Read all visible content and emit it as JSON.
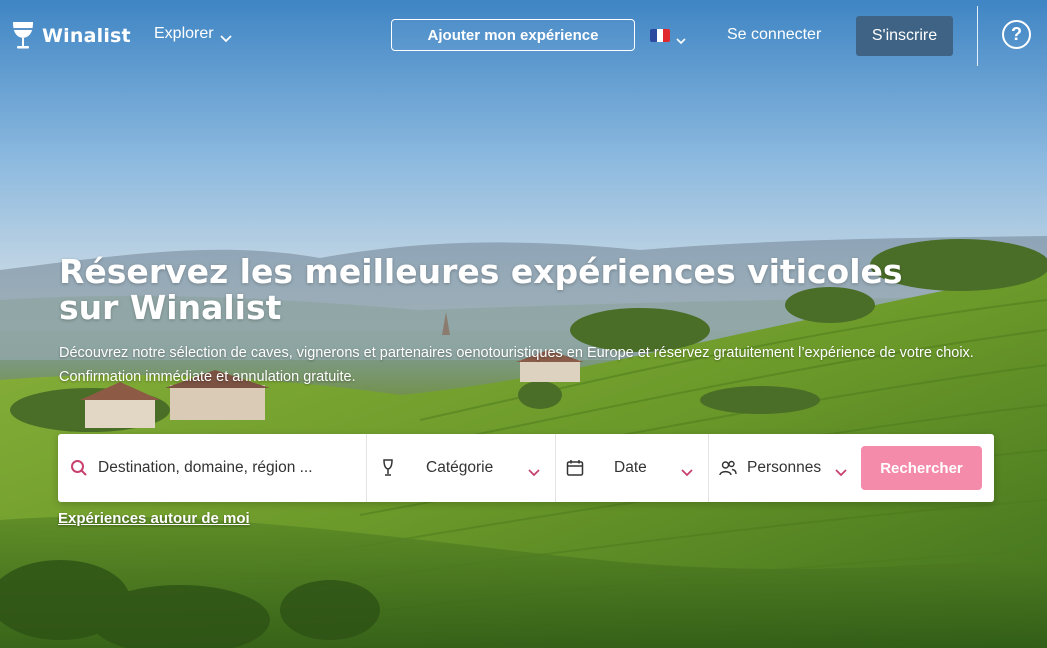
{
  "header": {
    "logo_text": "Winalist",
    "explorer_label": "Explorer",
    "add_experience_label": "Ajouter mon expérience",
    "language": "fr",
    "signin_label": "Se connecter",
    "signup_label": "S'inscrire",
    "help_label": "?"
  },
  "hero": {
    "title": "Réservez les meilleures expériences viticoles sur Winalist",
    "subtitle": "Découvrez notre sélection de caves, vignerons et partenaires oenotouristiques en Europe et réservez gratuitement l’expérience de votre choix. Confirmation immédiate et annulation gratuite."
  },
  "search": {
    "destination_placeholder": "Destination, domaine, région ...",
    "category_label": "Catégorie",
    "date_label": "Date",
    "persons_label": "Personnes",
    "submit_label": "Rechercher"
  },
  "nearby_link": "Expériences autour de moi",
  "icons": {
    "logo": "wine-glass-icon",
    "search": "search-icon",
    "category": "wine-glass-icon",
    "date": "calendar-icon",
    "persons": "users-icon",
    "chevron": "chevron-down-icon",
    "help": "help-icon"
  },
  "colors": {
    "accent_pink": "#f58bab",
    "chevron_pink": "#c8416d",
    "signup_bg": "#3f6384",
    "search_icon": "#c8416d"
  }
}
